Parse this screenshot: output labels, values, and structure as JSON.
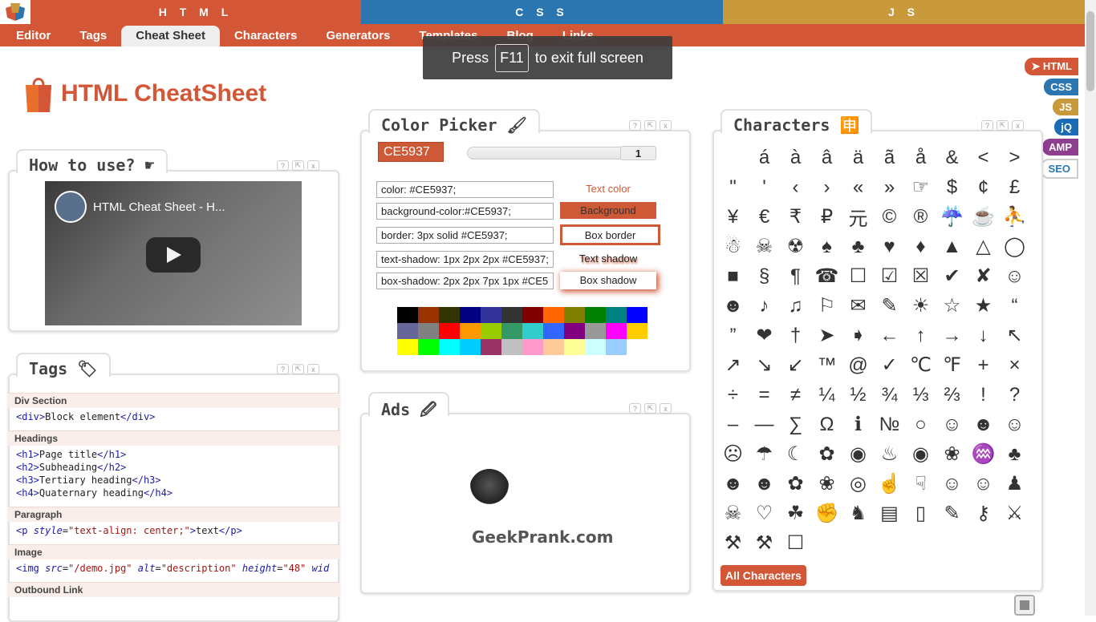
{
  "top_sections": {
    "html": "H T M L",
    "css": "C S S",
    "js": "J S"
  },
  "nav": [
    "Editor",
    "Tags",
    "Cheat Sheet",
    "Characters",
    "Generators",
    "Templates",
    "Blog",
    "Links"
  ],
  "fullscreen": {
    "press": "Press",
    "key": "F11",
    "rest": "to exit full screen"
  },
  "page_title": "HTML CheatSheet",
  "badges": [
    {
      "label": "➤ HTML",
      "color": "#d35736"
    },
    {
      "label": "CSS",
      "color": "#2b75b0"
    },
    {
      "label": "JS",
      "color": "#c99a3b"
    },
    {
      "label": "jQ",
      "color": "#1b6cb5"
    },
    {
      "label": "AMP",
      "color": "#8e3f8f"
    },
    {
      "label": "SEO",
      "color": "#ffffff"
    }
  ],
  "how": {
    "title": "How to use? ☛",
    "video_title": "HTML Cheat Sheet - H..."
  },
  "tags": {
    "title": "Tags 🏷",
    "sections": [
      {
        "name": "Div Section",
        "lines": [
          [
            [
              "t",
              "<div>"
            ],
            [
              "x",
              "Block element"
            ],
            [
              "t",
              "</div>"
            ]
          ]
        ]
      },
      {
        "name": "Headings",
        "lines": [
          [
            [
              "t",
              "<h1>"
            ],
            [
              "x",
              "Page title"
            ],
            [
              "t",
              "</h1>"
            ]
          ],
          [
            [
              "t",
              "<h2>"
            ],
            [
              "x",
              "Subheading"
            ],
            [
              "t",
              "</h2>"
            ]
          ],
          [
            [
              "t",
              "<h3>"
            ],
            [
              "x",
              "Tertiary heading"
            ],
            [
              "t",
              "</h3>"
            ]
          ],
          [
            [
              "t",
              "<h4>"
            ],
            [
              "x",
              "Quaternary heading"
            ],
            [
              "t",
              "</h4>"
            ]
          ]
        ]
      },
      {
        "name": "Paragraph",
        "lines": [
          [
            [
              "t",
              "<p "
            ],
            [
              "a",
              "style"
            ],
            [
              "x",
              "="
            ],
            [
              "v",
              "\"text-align: center;\""
            ],
            [
              "t",
              ">"
            ],
            [
              "x",
              "text"
            ],
            [
              "t",
              "</p>"
            ]
          ]
        ]
      },
      {
        "name": "Image",
        "lines": [
          [
            [
              "t",
              "<img "
            ],
            [
              "a",
              "src"
            ],
            [
              "x",
              "="
            ],
            [
              "v",
              "\"/demo.jpg\""
            ],
            [
              "x",
              " "
            ],
            [
              "a",
              "alt"
            ],
            [
              "x",
              "="
            ],
            [
              "v",
              "\"description\""
            ],
            [
              "x",
              " "
            ],
            [
              "a",
              "height"
            ],
            [
              "x",
              "="
            ],
            [
              "v",
              "\"48\""
            ],
            [
              "x",
              " "
            ],
            [
              "a",
              "wid"
            ]
          ]
        ]
      },
      {
        "name": "Outbound Link",
        "lines": []
      }
    ]
  },
  "color_picker": {
    "title": "Color Picker 🖌",
    "hex": "CE5937",
    "slider_value": "1",
    "rows": [
      {
        "input": "color: #CE5937;",
        "preview": "Text color"
      },
      {
        "input": "background-color:#CE5937;",
        "preview": "Background"
      },
      {
        "input": "border: 3px solid #CE5937;",
        "preview": "Box border"
      },
      {
        "input": "text-shadow: 1px 2px 2px #CE5937;",
        "preview": "Text shadow"
      },
      {
        "input": "box-shadow: 2px 2px 7px 1px #CE5",
        "preview": "Box shadow"
      }
    ],
    "accent": "#CE5937",
    "swatches": [
      "#000000",
      "#993300",
      "#333300",
      "#000080",
      "#333399",
      "#333333",
      "#800000",
      "#ff6600",
      "#808000",
      "#008000",
      "#008080",
      "#0000ff",
      "#666699",
      "#808080",
      "#ff0000",
      "#ff9900",
      "#99cc00",
      "#339966",
      "#33cccc",
      "#3366ff",
      "#800080",
      "#999999",
      "#ff00ff",
      "#ffcc00",
      "#ffff00",
      "#00ff00",
      "#00ffff",
      "#00ccff",
      "#993366",
      "#c0c0c0",
      "#ff99cc",
      "#ffcc99",
      "#ffff99",
      "#ccffff",
      "#99ccff"
    ]
  },
  "ads": {
    "title": "Ads 🖉",
    "text": "GeekPrank.com"
  },
  "characters": {
    "title": "Characters 🈸",
    "all_button": "All Characters",
    "items": [
      "",
      "á",
      "à",
      "â",
      "ä",
      "ã",
      "å",
      "&",
      "<",
      ">",
      "\"",
      "'",
      "‹",
      "›",
      "«",
      "»",
      "☞",
      "$",
      "¢",
      "£",
      "¥",
      "€",
      "₹",
      "₽",
      "元",
      "©",
      "®",
      "☔",
      "☕",
      "⛹",
      "☃",
      "☠",
      "☢",
      "♠",
      "♣",
      "♥",
      "♦",
      "▲",
      "△",
      "◯",
      "■",
      "§",
      "¶",
      "☎",
      "☐",
      "☑",
      "☒",
      "✔",
      "✘",
      "☺",
      "☻",
      "♪",
      "♫",
      "⚐",
      "✉",
      "✎",
      "☀",
      "☆",
      "★",
      "“",
      "”",
      "❤",
      "†",
      "➤",
      "➧",
      "←",
      "↑",
      "→",
      "↓",
      "↖",
      "↗",
      "↘",
      "↙",
      "™",
      "@",
      "✓",
      "℃",
      "℉",
      "+",
      "×",
      "÷",
      "=",
      "≠",
      "¼",
      "½",
      "¾",
      "⅓",
      "⅔",
      "!",
      "?",
      "–",
      "—",
      "∑",
      "Ω",
      "ℹ",
      "№",
      "○",
      "☺",
      "☻",
      "☺",
      "☹",
      "☂",
      "☾",
      "✿",
      "◉",
      "♨",
      "◉",
      "❀",
      "♒",
      "♣",
      "☻",
      "☻",
      "✿",
      "❀",
      "◎",
      "☝",
      "☟",
      "☺",
      "☺",
      "♟",
      "☠",
      "♡",
      "☘",
      "✊",
      "♞",
      "▤",
      "▯",
      "✎",
      "⚷",
      "⚔",
      "⚒",
      "⚒",
      "☐"
    ]
  }
}
